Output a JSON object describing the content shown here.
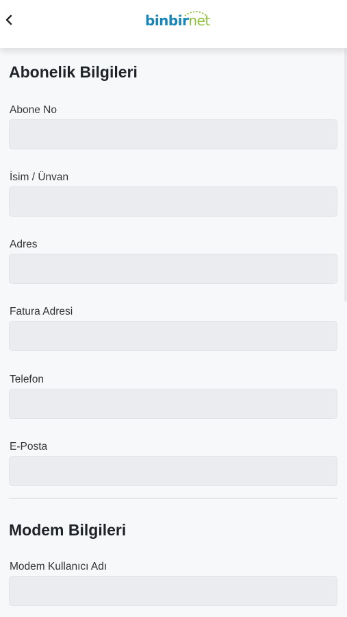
{
  "header": {
    "logo_part1": "binbir",
    "logo_part2": "net"
  },
  "sections": {
    "subscription": {
      "title": "Abonelik Bilgileri",
      "fields": [
        {
          "label": "Abone No",
          "value": ""
        },
        {
          "label": "İsim / Ünvan",
          "value": ""
        },
        {
          "label": "Adres",
          "value": ""
        },
        {
          "label": "Fatura Adresi",
          "value": ""
        },
        {
          "label": "Telefon",
          "value": ""
        },
        {
          "label": "E-Posta",
          "value": ""
        }
      ]
    },
    "modem": {
      "title": "Modem Bilgileri",
      "fields": [
        {
          "label": "Modem Kullanıcı Adı",
          "value": ""
        }
      ]
    }
  },
  "colors": {
    "logo_blue": "#1a86b8",
    "logo_green": "#8dc23b",
    "input_bg": "#eaecef"
  }
}
